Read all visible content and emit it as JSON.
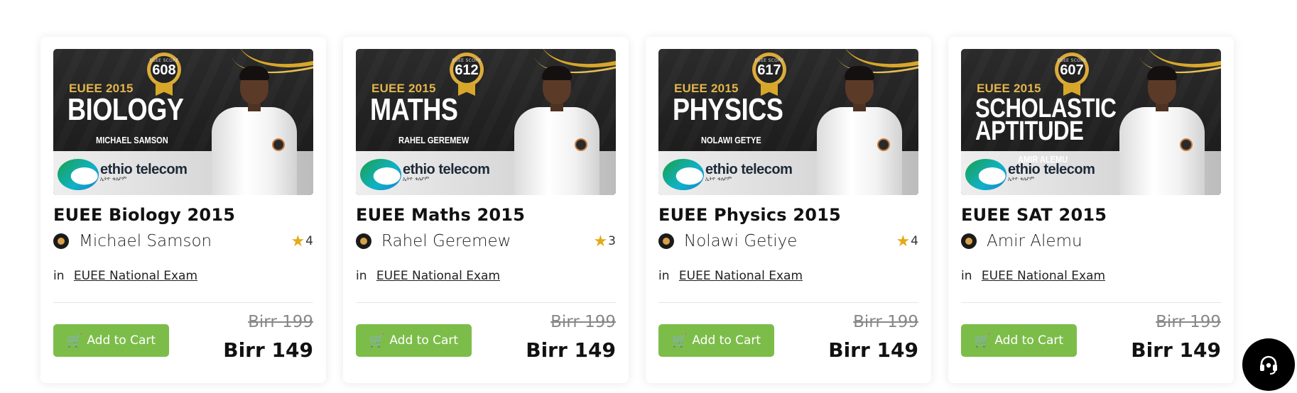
{
  "courses": [
    {
      "thumb": {
        "year": "EUEE 2015",
        "subject": "BIOLOGY",
        "person": "MICHAEL SAMSON",
        "score_label": "EUEE SCORE",
        "score": "608",
        "brand": "ethio telecom",
        "brand_sub": "ኢትዮ ቴሌኮም"
      },
      "title": "EUEE Biology 2015",
      "author": "Michael Samson",
      "rating": "4",
      "in_label": "in",
      "category": "EUEE National Exam",
      "old_price": "Birr 199",
      "price": "Birr 149",
      "cart_label": "Add to Cart"
    },
    {
      "thumb": {
        "year": "EUEE 2015",
        "subject": "MATHS",
        "person": "RAHEL GEREMEW",
        "score_label": "EUEE SCORE",
        "score": "612",
        "brand": "ethio telecom",
        "brand_sub": "ኢትዮ ቴሌኮም"
      },
      "title": "EUEE Maths 2015",
      "author": "Rahel Geremew",
      "rating": "3",
      "in_label": "in",
      "category": "EUEE National Exam",
      "old_price": "Birr 199",
      "price": "Birr 149",
      "cart_label": "Add to Cart"
    },
    {
      "thumb": {
        "year": "EUEE 2015",
        "subject": "PHYSICS",
        "person": "NOLAWI GETYE",
        "score_label": "EUEE SCORE",
        "score": "617",
        "brand": "ethio telecom",
        "brand_sub": "ኢትዮ ቴሌኮም"
      },
      "title": "EUEE Physics 2015",
      "author": "Nolawi Getiye",
      "rating": "4",
      "in_label": "in",
      "category": "EUEE National Exam",
      "old_price": "Birr 199",
      "price": "Birr 149",
      "cart_label": "Add to Cart"
    },
    {
      "thumb": {
        "year": "EUEE 2015",
        "subject": "SCHOLASTIC APTITUDE",
        "person": "AMIR ALEMU",
        "score_label": "EUEE SCORE",
        "score": "607",
        "brand": "ethio telecom",
        "brand_sub": "ኢትዮ ቴሌኮም"
      },
      "title": "EUEE SAT 2015",
      "author": "Amir Alemu",
      "rating": "",
      "in_label": "in",
      "category": "EUEE National Exam",
      "old_price": "Birr 199",
      "price": "Birr 149",
      "cart_label": "Add to Cart"
    }
  ],
  "colors": {
    "accent_green": "#7cbd4a",
    "star": "#e6a917",
    "gold": "#d8a72a"
  },
  "icons": {
    "cart": "cart-icon",
    "star": "star-icon",
    "support": "headset-icon"
  }
}
